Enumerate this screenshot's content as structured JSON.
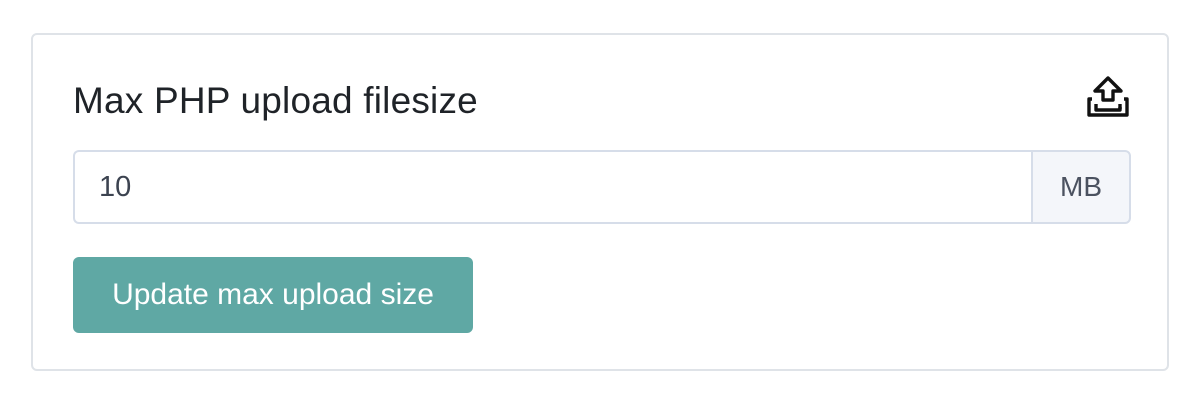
{
  "card": {
    "title": "Max PHP upload filesize",
    "icon": "upload-tray-icon"
  },
  "upload_size": {
    "value": "10",
    "unit": "MB"
  },
  "actions": {
    "update_label": "Update max upload size"
  },
  "colors": {
    "button_bg": "#5fa8a4",
    "border": "#dfe3e8",
    "addon_bg": "#f4f6fa",
    "text": "#1f2328"
  }
}
